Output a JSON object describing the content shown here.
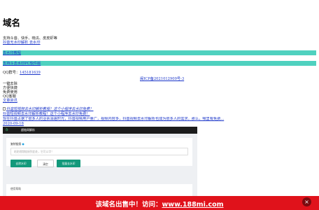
{
  "page": {
    "title": "域名",
    "intro": "支持斗音、快手、晓瓜、皮皮虾等",
    "intro_link": "抖音无水印解析 去水印"
  },
  "nav_bars": [
    "去水印教程",
    "支持斗去水印PC软件版"
  ],
  "contact": {
    "qq_label": "QQ群号：",
    "qq_number": "145181639"
  },
  "icp": "闽ICP备2021012909号-3",
  "features": [
    "一键去除",
    "方便快捷",
    "免费使用",
    "QQ客服",
    "文章资讯"
  ],
  "article": {
    "image_alt": "抖音短视频去水印解析教程！这个小程序去水印免费！",
    "title": "抖音短视频去水印解析教程！这个小程序去水印免费！",
    "description": "现在抖音占据了很多人的业余消遣时光，抖音视频用户量广，视频内容多，抖音视频去水印解析也成为很多人的需求，那么，哪里有免费...",
    "date": "2020-09-18"
  },
  "app_preview": {
    "header_title": "超链网解析",
    "card_label": "复制链接",
    "input_placeholder": "粘贴视频链接到此处，它可以字！",
    "buttons": {
      "remove": "去除水印",
      "clear": "清空",
      "batch": "批量去水印"
    },
    "help_label": "使用帮助"
  },
  "sale_banner": {
    "text": "该域名出售中！访问：",
    "link": "www.188mi.com",
    "close": "×"
  },
  "colors": {
    "teal_bar": "#4fd1bf",
    "sale_red": "#e0121b",
    "button_green": "#13997b",
    "link_blue": "#1a35c9"
  }
}
